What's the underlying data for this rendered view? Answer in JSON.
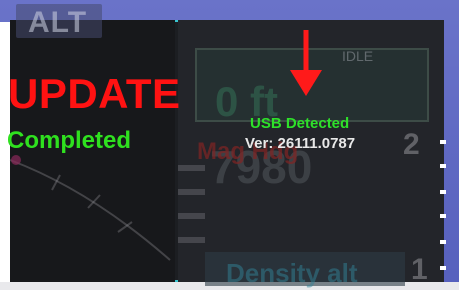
{
  "background": {
    "alt_label": "ALT",
    "idle_label": "IDLE",
    "altitude_value": "0 ft",
    "heading_value": "7980",
    "magnetic_label": "Mag Hdg",
    "density_alt_label": "Density alt",
    "scale_markers": [
      "2",
      "1"
    ]
  },
  "update_overlay": {
    "title": "UPDATE",
    "status": "Completed"
  },
  "usb_status": {
    "detected_text": "USB Detected",
    "version_text": "Ver: 26111.0787"
  },
  "annotation": {
    "arrow_icon": "down-arrow-icon",
    "arrow_color": "#ff1a1a"
  },
  "colors": {
    "update_red": "#ff1212",
    "completed_green": "#2fe01f",
    "usb_green": "#2ee02a",
    "screen_border": "#39c4cf",
    "frame_blue": "#5d66c3"
  }
}
